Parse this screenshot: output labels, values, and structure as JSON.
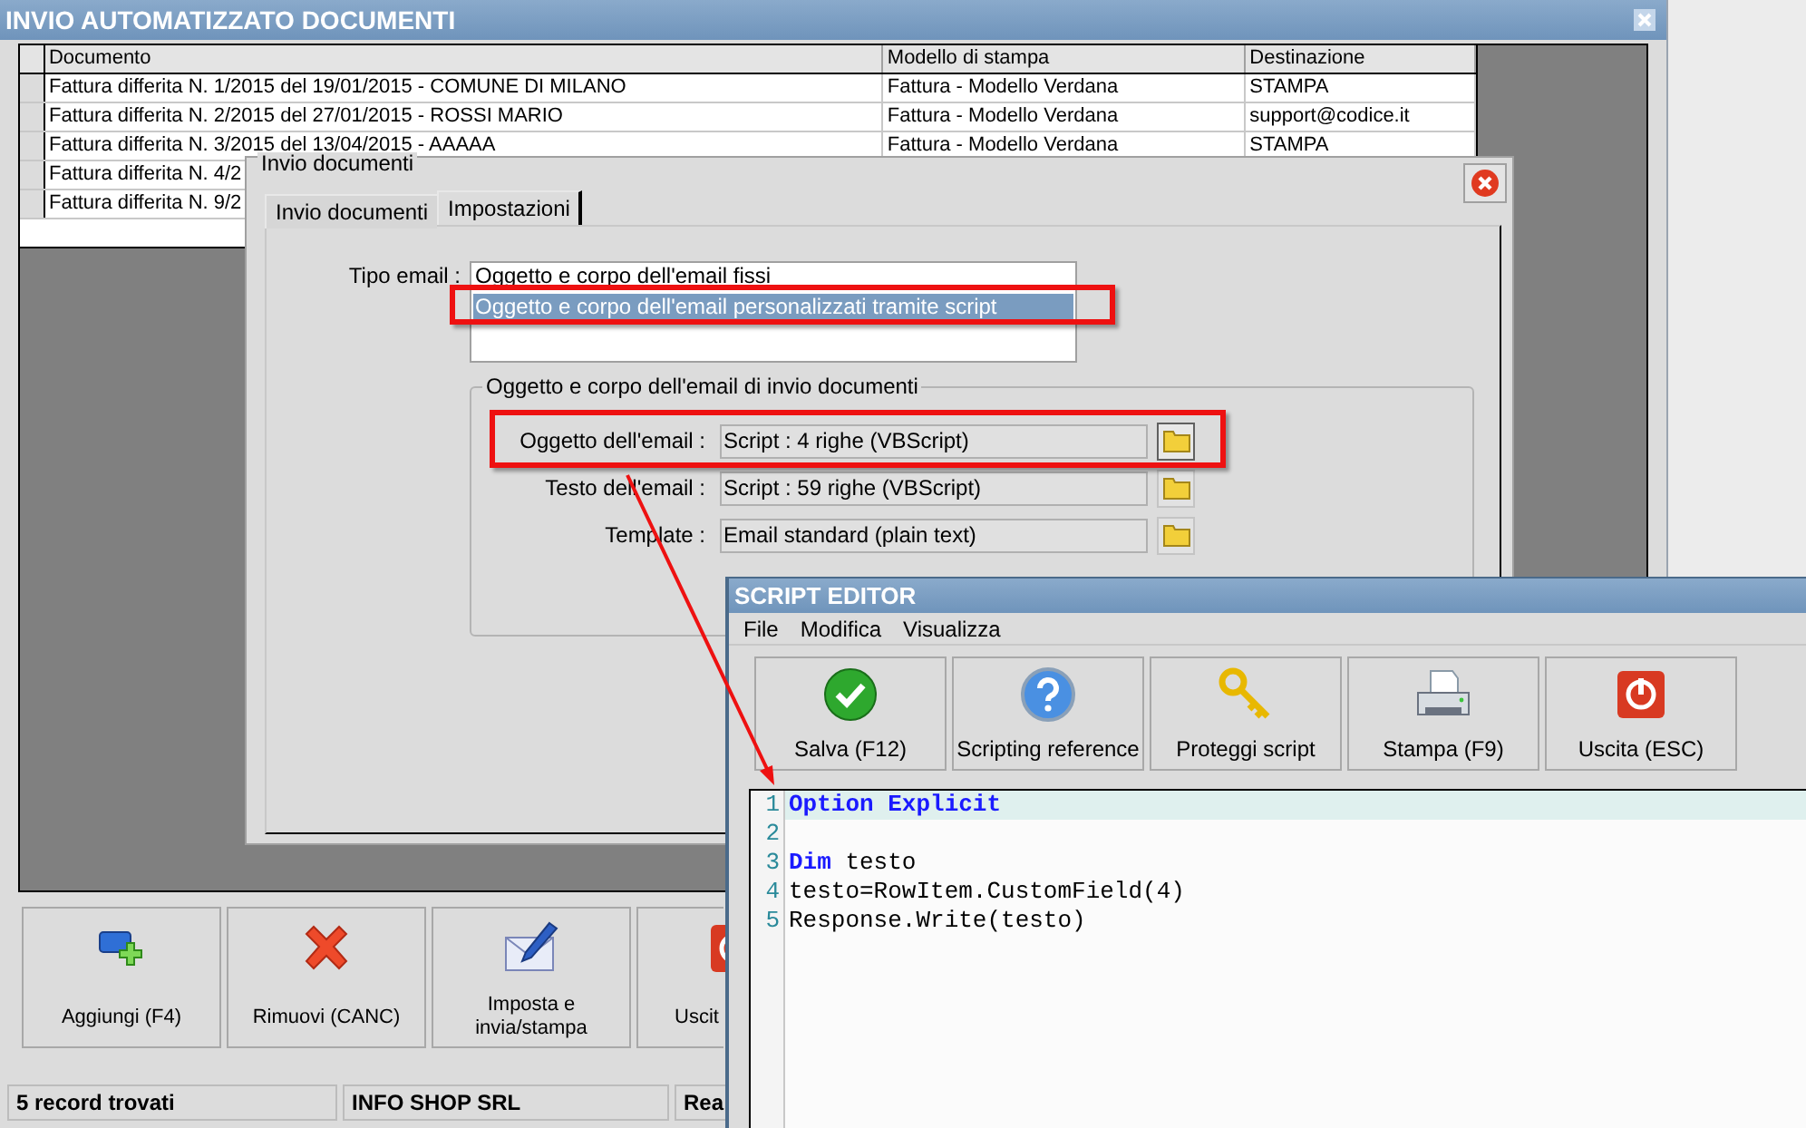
{
  "window": {
    "title": "INVIO AUTOMATIZZATO DOCUMENTI"
  },
  "table": {
    "columns": [
      "Documento",
      "Modello di stampa",
      "Destinazione"
    ],
    "rows": [
      {
        "cells": [
          "Fattura differita N. 1/2015 del 19/01/2015 - COMUNE DI MILANO",
          "Fattura - Modello Verdana",
          "STAMPA"
        ]
      },
      {
        "cells": [
          "Fattura differita N. 2/2015 del 27/01/2015 - ROSSI MARIO",
          "Fattura - Modello Verdana",
          "support@codice.it"
        ]
      },
      {
        "cells": [
          "Fattura differita N. 3/2015 del 13/04/2015 - AAAAA",
          "Fattura - Modello Verdana",
          "STAMPA"
        ]
      },
      {
        "cells": [
          "Fattura differita N. 4/2"
        ]
      },
      {
        "cells": [
          "Fattura differita N. 9/2"
        ]
      }
    ]
  },
  "toolbar": [
    {
      "label": "Aggiungi (F4)",
      "kind": "add"
    },
    {
      "label": "Rimuovi (CANC)",
      "kind": "remove"
    },
    {
      "label": "Imposta e invia/stampa",
      "kind": "send"
    },
    {
      "label": "Uscit",
      "kind": "exit"
    }
  ],
  "status_bar": [
    "5 record trovati",
    "INFO SHOP SRL",
    "Rea"
  ],
  "dialog": {
    "title": "Invio documenti",
    "tabs": [
      {
        "label": "Invio documenti",
        "selected": false
      },
      {
        "label": "Impostazioni",
        "selected": true
      }
    ],
    "email_type": {
      "label": "Tipo email :",
      "options": [
        {
          "label": "Oggetto e corpo dell'email fissi",
          "selected": false
        },
        {
          "label": "Oggetto e corpo dell'email personalizzati tramite script",
          "selected": true
        }
      ]
    },
    "group": {
      "title": "Oggetto e corpo dell'email di invio documenti",
      "fields": [
        {
          "label": "Oggetto dell'email :",
          "value": "Script : 4 righe (VBScript)"
        },
        {
          "label": "Testo dell'email :",
          "value": "Script : 59 righe (VBScript)"
        },
        {
          "label": "Template :",
          "value": "Email standard (plain text)"
        }
      ]
    }
  },
  "script_editor": {
    "title": "SCRIPT EDITOR",
    "menu": [
      "File",
      "Modifica",
      "Visualizza"
    ],
    "buttons": [
      {
        "label": "Salva (F12)",
        "kind": "save"
      },
      {
        "label": "Scripting reference",
        "kind": "help"
      },
      {
        "label": "Proteggi script",
        "kind": "protect"
      },
      {
        "label": "Stampa (F9)",
        "kind": "print"
      },
      {
        "label": "Uscita (ESC)",
        "kind": "exit"
      }
    ],
    "code_lines": [
      {
        "number": "1",
        "current": true,
        "tokens": [
          {
            "text": "Option Explicit",
            "kind": "keyword"
          }
        ]
      },
      {
        "number": "2",
        "current": false
      },
      {
        "number": "3",
        "current": false,
        "tokens": [
          {
            "text": "Dim",
            "kind": "keyword"
          },
          {
            "text": " testo",
            "kind": "plain"
          }
        ]
      },
      {
        "number": "4",
        "current": false,
        "tokens": [
          {
            "text": "testo=RowItem.CustomField(4)",
            "kind": "plain"
          }
        ]
      },
      {
        "number": "5",
        "current": false,
        "tokens": [
          {
            "text": "Response.Write(testo)",
            "kind": "plain"
          }
        ]
      }
    ]
  }
}
